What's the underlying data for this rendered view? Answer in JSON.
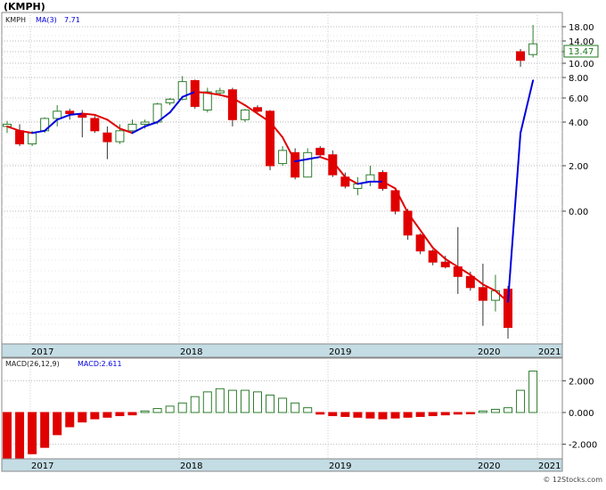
{
  "header": {
    "ticker_label": "(KMPH)"
  },
  "main_panel": {
    "legend_ticker": "KMPH",
    "legend_ma": "MA(3)",
    "legend_ma_value": "7.71",
    "last_price_label": "13.47",
    "y_ticks": [
      "18.00",
      "14.00",
      "12.00",
      "10.00",
      "8.00",
      "6.00",
      "4.00",
      "2.00",
      "0.00"
    ],
    "x_ticks": [
      "2017",
      "2018",
      "2019",
      "2020",
      "2021"
    ]
  },
  "macd_panel": {
    "legend_params": "MACD(26,12,9)",
    "legend_value": "MACD:2.611",
    "y_ticks": [
      "2.000",
      "0.000",
      "-2.000"
    ],
    "x_ticks": [
      "2017",
      "2018",
      "2019",
      "2020",
      "2021"
    ]
  },
  "footer": {
    "credit": "© 12Stocks.com"
  },
  "colors": {
    "up_candle": "#2e7d2e",
    "down_candle": "#e00000",
    "ma_up": "#0000dd",
    "ma_down": "#e00000",
    "axis_bar": "#c4dce4",
    "last_price_border": "#1a7a1a"
  },
  "chart_data": [
    {
      "type": "candlestick",
      "title": "(KMPH)",
      "x_ticks": [
        "2017",
        "2018",
        "2019",
        "2020",
        "2021"
      ],
      "y_scale": "non-linear price scale",
      "y_ticks": [
        18,
        14,
        12,
        10,
        8,
        6,
        4,
        2,
        0
      ],
      "candles": [
        {
          "o": 3.8,
          "h": 4.1,
          "l": 3.5,
          "c": 3.9
        },
        {
          "o": 3.6,
          "h": 3.9,
          "l": 2.9,
          "c": 3.0
        },
        {
          "o": 3.0,
          "h": 3.6,
          "l": 2.9,
          "c": 3.5
        },
        {
          "o": 3.6,
          "h": 4.4,
          "l": 3.5,
          "c": 4.3
        },
        {
          "o": 4.3,
          "h": 5.4,
          "l": 3.8,
          "c": 4.9
        },
        {
          "o": 4.9,
          "h": 5.1,
          "l": 4.2,
          "c": 4.7
        },
        {
          "o": 4.7,
          "h": 5.0,
          "l": 3.3,
          "c": 4.4
        },
        {
          "o": 4.3,
          "h": 4.5,
          "l": 3.5,
          "c": 3.6
        },
        {
          "o": 3.5,
          "h": 3.8,
          "l": 2.3,
          "c": 3.1
        },
        {
          "o": 3.1,
          "h": 3.9,
          "l": 3.0,
          "c": 3.6
        },
        {
          "o": 3.6,
          "h": 4.2,
          "l": 3.5,
          "c": 3.9
        },
        {
          "o": 3.9,
          "h": 4.2,
          "l": 3.7,
          "c": 4.0
        },
        {
          "o": 4.0,
          "h": 5.6,
          "l": 3.9,
          "c": 5.5
        },
        {
          "o": 5.6,
          "h": 6.0,
          "l": 5.4,
          "c": 5.9
        },
        {
          "o": 5.9,
          "h": 8.2,
          "l": 5.8,
          "c": 7.6
        },
        {
          "o": 7.7,
          "h": 7.8,
          "l": 5.1,
          "c": 5.3
        },
        {
          "o": 5.0,
          "h": 7.0,
          "l": 4.8,
          "c": 6.6
        },
        {
          "o": 6.5,
          "h": 7.0,
          "l": 6.2,
          "c": 6.7
        },
        {
          "o": 6.8,
          "h": 7.0,
          "l": 3.8,
          "c": 4.2
        },
        {
          "o": 4.2,
          "h": 5.1,
          "l": 4.0,
          "c": 5.0
        },
        {
          "o": 5.2,
          "h": 5.4,
          "l": 4.8,
          "c": 4.9
        },
        {
          "o": 4.9,
          "h": 5.0,
          "l": 1.8,
          "c": 2.0
        },
        {
          "o": 2.1,
          "h": 2.9,
          "l": 2.0,
          "c": 2.7
        },
        {
          "o": 2.6,
          "h": 2.8,
          "l": 1.4,
          "c": 1.5
        },
        {
          "o": 1.5,
          "h": 2.8,
          "l": 1.5,
          "c": 2.6
        },
        {
          "o": 2.8,
          "h": 2.9,
          "l": 2.4,
          "c": 2.5
        },
        {
          "o": 2.5,
          "h": 2.7,
          "l": 1.5,
          "c": 1.6
        },
        {
          "o": 1.5,
          "h": 1.7,
          "l": 1.0,
          "c": 1.1
        },
        {
          "o": 1.0,
          "h": 1.5,
          "l": 0.7,
          "c": 1.2
        },
        {
          "o": 1.3,
          "h": 2.0,
          "l": 1.1,
          "c": 1.6
        },
        {
          "o": 1.7,
          "h": 1.8,
          "l": 0.9,
          "c": 1.0
        },
        {
          "o": 0.9,
          "h": 1.0,
          "l": -0.2,
          "c": 0.0
        },
        {
          "o": 0.0,
          "h": 0.1,
          "l": -1.8,
          "c": -1.5
        },
        {
          "o": -1.5,
          "h": -1.4,
          "l": -2.7,
          "c": -2.5
        },
        {
          "o": -2.5,
          "h": -2.4,
          "l": -3.4,
          "c": -3.2
        },
        {
          "o": -3.2,
          "h": -2.8,
          "l": -3.6,
          "c": -3.5
        },
        {
          "o": -3.5,
          "h": -1.0,
          "l": -5.2,
          "c": -4.1
        },
        {
          "o": -4.1,
          "h": -3.8,
          "l": -5.0,
          "c": -4.8
        },
        {
          "o": -4.8,
          "h": -3.3,
          "l": -7.2,
          "c": -5.6
        },
        {
          "o": -5.6,
          "h": -4.0,
          "l": -6.3,
          "c": -5.0
        },
        {
          "o": -4.9,
          "h": -4.7,
          "l": -8.3,
          "c": -7.3
        },
        {
          "o": 12.0,
          "h": 12.5,
          "l": 9.5,
          "c": 10.5
        },
        {
          "o": 11.5,
          "h": 18.5,
          "l": 11.0,
          "c": 13.47
        }
      ],
      "series": [
        {
          "name": "MA(3)",
          "values": [
            3.8,
            3.6,
            3.5,
            3.6,
            4.2,
            4.6,
            4.7,
            4.6,
            4.2,
            3.7,
            3.5,
            3.8,
            4.0,
            4.8,
            6.1,
            6.6,
            6.5,
            6.3,
            6.0,
            5.4,
            4.7,
            4.0,
            3.3,
            2.2,
            2.3,
            2.4,
            2.2,
            1.5,
            1.2,
            1.3,
            1.3,
            1.0,
            -0.1,
            -1.2,
            -2.3,
            -3.0,
            -3.5,
            -4.0,
            -4.6,
            -5.0,
            -5.7,
            3.5,
            7.71
          ]
        }
      ]
    },
    {
      "type": "bar",
      "title": "MACD(26,12,9)",
      "y_ticks": [
        2.0,
        0.0,
        -2.0
      ],
      "values": [
        -3.2,
        -3.0,
        -2.6,
        -2.2,
        -1.4,
        -0.9,
        -0.6,
        -0.4,
        -0.3,
        -0.2,
        -0.15,
        0.1,
        0.25,
        0.4,
        0.6,
        1.0,
        1.3,
        1.5,
        1.4,
        1.4,
        1.3,
        1.1,
        0.9,
        0.6,
        0.3,
        -0.1,
        -0.2,
        -0.25,
        -0.3,
        -0.35,
        -0.4,
        -0.35,
        -0.3,
        -0.25,
        -0.2,
        -0.15,
        -0.1,
        -0.05,
        0.1,
        0.2,
        0.3,
        1.4,
        2.611
      ]
    }
  ]
}
